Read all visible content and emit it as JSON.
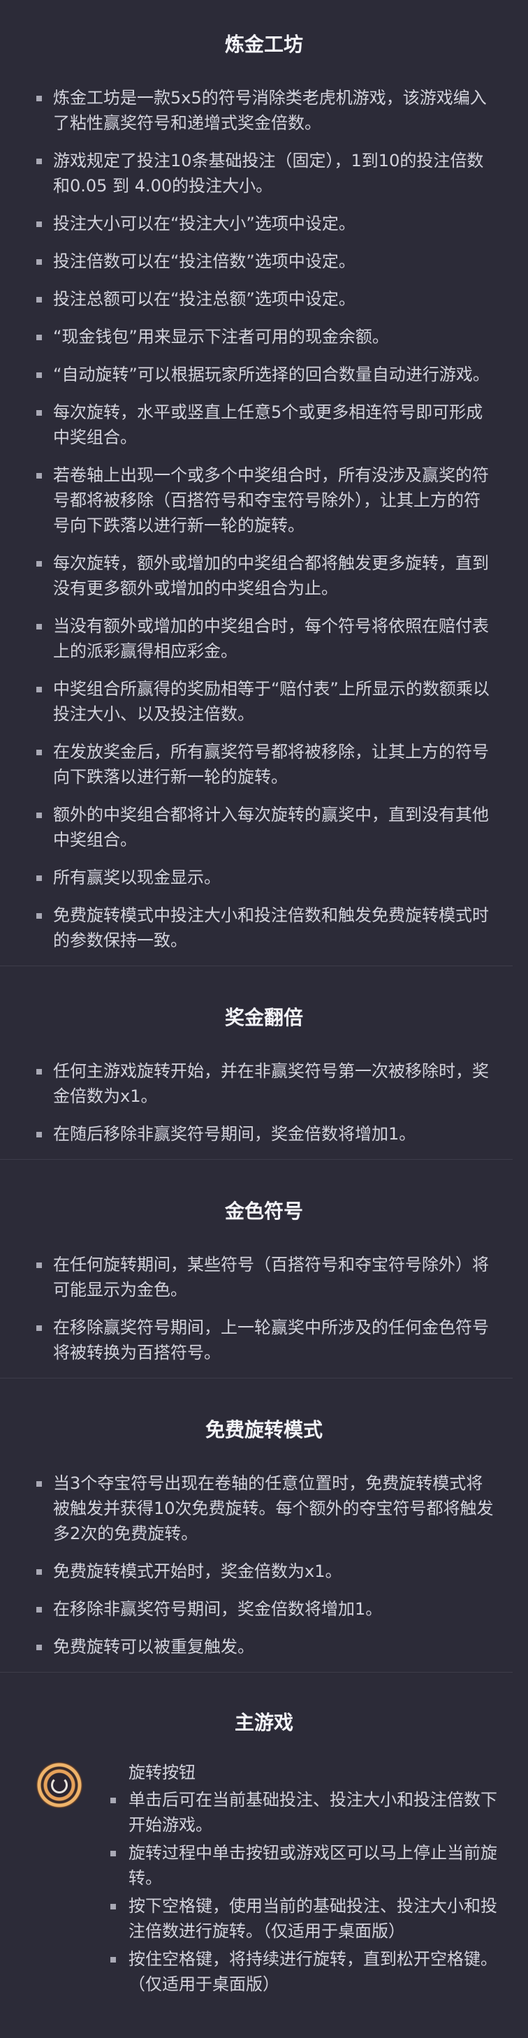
{
  "sections": {
    "intro": {
      "title": "炼金工坊",
      "items": [
        "炼金工坊是一款5x5的符号消除类老虎机游戏，该游戏编入了粘性赢奖符号和递增式奖金倍数。",
        "游戏规定了投注10条基础投注（固定），1到10的投注倍数和0.05 到 4.00的投注大小。",
        "投注大小可以在“投注大小”选项中设定。",
        "投注倍数可以在“投注倍数”选项中设定。",
        "投注总额可以在“投注总额”选项中设定。",
        "“现金钱包”用来显示下注者可用的现金余额。",
        "“自动旋转”可以根据玩家所选择的回合数量自动进行游戏。",
        "每次旋转，水平或竖直上任意5个或更多相连符号即可形成中奖组合。",
        "若卷轴上出现一个或多个中奖组合时，所有没涉及赢奖的符号都将被移除（百搭符号和夺宝符号除外），让其上方的符号向下跌落以进行新一轮的旋转。",
        "每次旋转，额外或增加的中奖组合都将触发更多旋转，直到没有更多额外或增加的中奖组合为止。",
        "当没有额外或增加的中奖组合时，每个符号将依照在赔付表上的派彩赢得相应彩金。",
        "中奖组合所赢得的奖励相等于“赔付表”上所显示的数额乘以投注大小、以及投注倍数。",
        "在发放奖金后，所有赢奖符号都将被移除，让其上方的符号向下跌落以进行新一轮的旋转。",
        "额外的中奖组合都将计入每次旋转的赢奖中，直到没有其他中奖组合。",
        "所有赢奖以现金显示。",
        "免费旋转模式中投注大小和投注倍数和触发免费旋转模式时的参数保持一致。"
      ]
    },
    "multiplier": {
      "title": "奖金翻倍",
      "items": [
        "任何主游戏旋转开始，并在非赢奖符号第一次被移除时，奖金倍数为x1。",
        "在随后移除非赢奖符号期间，奖金倍数将增加1。"
      ]
    },
    "gold": {
      "title": "金色符号",
      "items": [
        "在任何旋转期间，某些符号（百搭符号和夺宝符号除外）将可能显示为金色。",
        "在移除赢奖符号期间，上一轮赢奖中所涉及的任何金色符号将被转换为百搭符号。"
      ]
    },
    "freespin": {
      "title": "免费旋转模式",
      "items": [
        "当3个夺宝符号出现在卷轴的任意位置时，免费旋转模式将被触发并获得10次免费旋转。每个额外的夺宝符号都将触发多2次的免费旋转。",
        "免费旋转模式开始时，奖金倍数为x1。",
        "在移除非赢奖符号期间，奖金倍数将增加1。",
        "免费旋转可以被重复触发。"
      ]
    },
    "maingame": {
      "title": "主游戏",
      "spin_button": {
        "icon": "spin-button-icon",
        "heading": "旋转按钮",
        "items": [
          "单击后可在当前基础投注、投注大小和投注倍数下开始游戏。",
          "旋转过程中单击按钮或游戏区可以马上停止当前旋转。",
          "按下空格键，使用当前的基础投注、投注大小和投注倍数进行旋转。（仅适用于桌面版）",
          "按住空格键，将持续进行旋转，直到松开空格键。（仅适用于桌面版）"
        ]
      }
    }
  }
}
